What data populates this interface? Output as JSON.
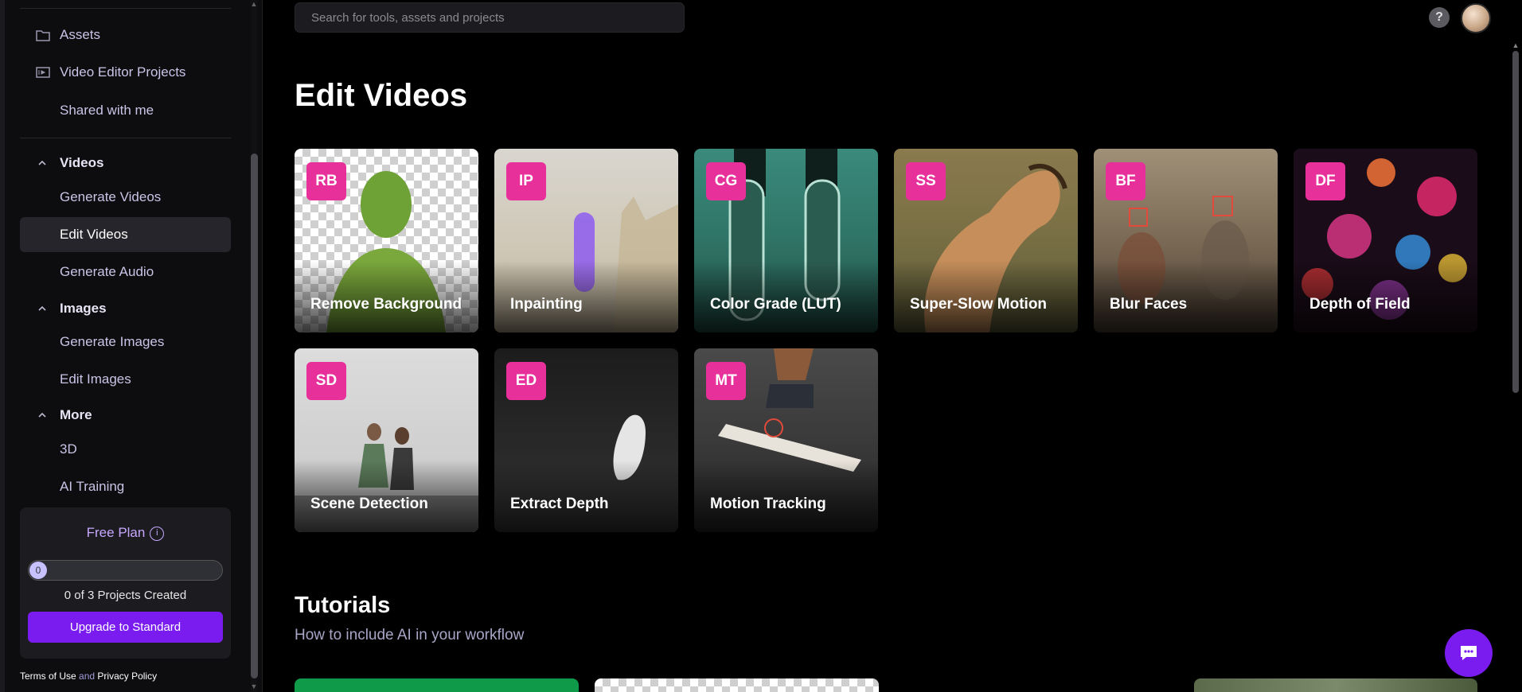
{
  "sidebar": {
    "top_items": [
      {
        "label": "Assets",
        "icon": "folder-icon"
      },
      {
        "label": "Video Editor Projects",
        "icon": "video-projects-icon"
      },
      {
        "label": "Shared with me",
        "icon": ""
      }
    ],
    "sections": [
      {
        "title": "Videos",
        "items": [
          "Generate Videos",
          "Edit Videos",
          "Generate Audio"
        ]
      },
      {
        "title": "Images",
        "items": [
          "Generate Images",
          "Edit Images"
        ]
      },
      {
        "title": "More",
        "items": [
          "3D",
          "AI Training"
        ]
      }
    ],
    "active_item": "Edit Videos",
    "plan": {
      "title": "Free Plan",
      "progress_value": "0",
      "progress_fraction": 0,
      "count_text": "0 of 3 Projects Created",
      "upgrade_label": "Upgrade to Standard"
    },
    "footer": {
      "terms": "Terms of Use",
      "and": "and",
      "privacy": "Privacy Policy"
    }
  },
  "header": {
    "search_placeholder": "Search for tools, assets and projects",
    "help_label": "?"
  },
  "main": {
    "title": "Edit Videos",
    "tools": [
      {
        "badge": "RB",
        "label": "Remove Background"
      },
      {
        "badge": "IP",
        "label": "Inpainting"
      },
      {
        "badge": "CG",
        "label": "Color Grade (LUT)"
      },
      {
        "badge": "SS",
        "label": "Super-Slow Motion"
      },
      {
        "badge": "BF",
        "label": "Blur Faces"
      },
      {
        "badge": "DF",
        "label": "Depth of Field"
      },
      {
        "badge": "SD",
        "label": "Scene Detection"
      },
      {
        "badge": "ED",
        "label": "Extract Depth"
      },
      {
        "badge": "MT",
        "label": "Motion Tracking"
      }
    ],
    "tutorials": {
      "title": "Tutorials",
      "subtitle": "How to include AI in your workflow"
    }
  },
  "colors": {
    "accent": "#7a1cf0",
    "badge": "#e8309b",
    "plan_text": "#c7a8ff"
  }
}
